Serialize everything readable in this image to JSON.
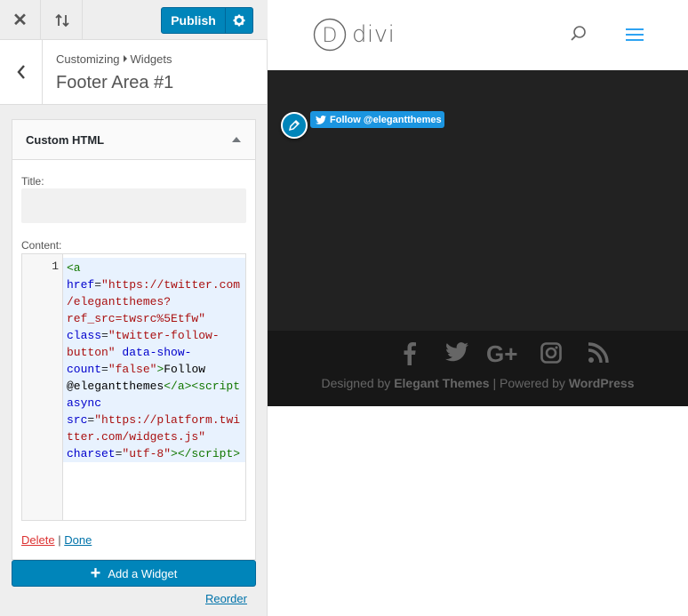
{
  "topbar": {
    "close_label": "Close",
    "reorder_label": "Reorder",
    "publish_label": "Publish"
  },
  "section": {
    "breadcrumb_root": "Customizing",
    "breadcrumb_child": "Widgets",
    "title": "Footer Area #1"
  },
  "widget": {
    "name": "Custom HTML",
    "title_label": "Title:",
    "title_value": "",
    "content_label": "Content:",
    "line_number": "1",
    "delete_label": "Delete",
    "separator": "|",
    "done_label": "Done"
  },
  "add_widget_label": "Add a Widget",
  "reorder_label": "Reorder",
  "preview": {
    "logo_letter": "D",
    "logo_text": "divi",
    "follow_button_label": "Follow @elegantthemes",
    "credits_designed": "Designed by",
    "credits_elegant": "Elegant Themes",
    "credits_sep": "| Powered by",
    "credits_wp": "WordPress",
    "social_icons": [
      "facebook-icon",
      "twitter-icon",
      "google-plus-icon",
      "instagram-icon",
      "rss-icon"
    ]
  },
  "colors": {
    "accent": "#0085ba",
    "twitter": "#1b95e0",
    "delete": "#dc3232",
    "footer_bg": "#222222",
    "footer_bottom_bg": "#171717"
  }
}
